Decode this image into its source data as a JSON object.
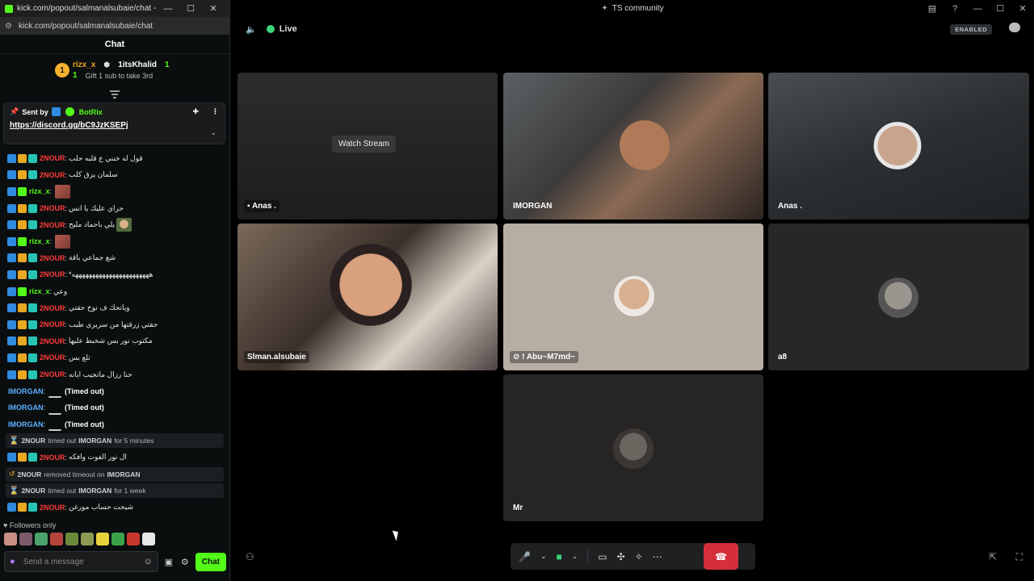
{
  "chat_window": {
    "title": "kick.com/popout/salmanalsubaie/chat - Google...",
    "url": "kick.com/popout/salmanalsubaie/chat",
    "header": "Chat",
    "leaderboard": {
      "rank": "1",
      "first": {
        "name": "rizx_x",
        "count": "1"
      },
      "second": {
        "name": "1itsKhalid",
        "count": "1"
      },
      "gift_text": "Gift 1 sub to take 3rd"
    },
    "pinned": {
      "sent_by_label": "Sent by",
      "bot_name": "BotRix",
      "link": "https://discord.gg/bC9JzKSEPj"
    },
    "messages": [
      {
        "badges": [
          "blue",
          "gold",
          "teal"
        ],
        "user": "2NOUR",
        "color": "red",
        "text": "قول له خنني ع قلبه حلب"
      },
      {
        "badges": [
          "blue",
          "gold",
          "teal"
        ],
        "user": "2NOUR",
        "color": "red",
        "text": "سلمان يزق كلب"
      },
      {
        "badges": [
          "blue",
          "green"
        ],
        "user": "rizx_x",
        "color": "green",
        "text": "",
        "emote": "red"
      },
      {
        "badges": [
          "blue",
          "gold",
          "teal"
        ],
        "user": "2NOUR",
        "color": "red",
        "text": "حراي عليك يا انس"
      },
      {
        "badges": [
          "blue",
          "gold",
          "teal"
        ],
        "user": "2NOUR",
        "color": "red",
        "text": "يلي باحماد مليح",
        "emote": "face"
      },
      {
        "badges": [
          "blue",
          "green"
        ],
        "user": "rizx_x",
        "color": "green",
        "text": "",
        "emote": "red"
      },
      {
        "badges": [
          "blue",
          "gold",
          "teal"
        ],
        "user": "2NOUR",
        "color": "red",
        "text": "شع جماعي باقة"
      },
      {
        "badges": [
          "blue",
          "gold",
          "teal"
        ],
        "user": "2NOUR",
        "color": "red",
        "text": "*هههههههههههههههههههههههه"
      },
      {
        "badges": [
          "blue",
          "green"
        ],
        "user": "rizx_x",
        "color": "green",
        "text": "وعي"
      },
      {
        "badges": [
          "blue",
          "gold",
          "teal"
        ],
        "user": "2NOUR",
        "color": "red",
        "text": "ويانحك ف نوح حقتي"
      },
      {
        "badges": [
          "blue",
          "gold",
          "teal"
        ],
        "user": "2NOUR",
        "color": "red",
        "text": "حقتي زرقتها من سريري طيب"
      },
      {
        "badges": [
          "blue",
          "gold",
          "teal"
        ],
        "user": "2NOUR",
        "color": "red",
        "text": "مكتوب نور بس شخبط عليها"
      },
      {
        "badges": [
          "blue",
          "gold",
          "teal"
        ],
        "user": "2NOUR",
        "color": "red",
        "text": "تلع بس"
      },
      {
        "badges": [
          "blue",
          "gold",
          "teal"
        ],
        "user": "2NOUR",
        "color": "red",
        "text": "حنا رزال ماتجيب ابانه"
      },
      {
        "badges": [],
        "user": "IMORGAN",
        "color": "blue",
        "text": "",
        "emote": "white",
        "timed_out": "(Timed out)"
      },
      {
        "badges": [],
        "user": "IMORGAN",
        "color": "blue",
        "text": "",
        "emote": "white",
        "timed_out": "(Timed out)"
      },
      {
        "badges": [],
        "user": "IMORGAN",
        "color": "blue",
        "text": "",
        "emote": "white",
        "timed_out": "(Timed out)"
      }
    ],
    "system_1": {
      "actor": "2NOUR",
      "verb": "timed out",
      "target": "IMORGAN",
      "suffix": "for 5 minutes"
    },
    "msg_after_sys1": {
      "user": "2NOUR",
      "text": "ال نور الفوت وافكه"
    },
    "system_2": {
      "actor": "2NOUR",
      "verb": "removed timeout on",
      "target": "IMORGAN"
    },
    "system_3": {
      "actor": "2NOUR",
      "verb": "timed out",
      "target": "IMORGAN",
      "suffix": "for 1 week"
    },
    "msg_last": {
      "user": "2NOUR",
      "text": "شيحت حساب مورغن"
    },
    "followers_only": "Followers only",
    "input_placeholder": "Send a message",
    "chat_button": "Chat"
  },
  "call_window": {
    "title": "TS community",
    "status": "Live",
    "enabled_badge": "ENABLED",
    "watch_stream": "Watch Stream",
    "tiles": [
      {
        "name": "Anas ."
      },
      {
        "name": "IMORGAN"
      },
      {
        "name": "Anas ."
      },
      {
        "name": "Slman.alsubaie"
      },
      {
        "name": "! Abu~M7md~"
      },
      {
        "name": "a8"
      },
      {
        "name": "Mr"
      }
    ]
  },
  "colors": {
    "kick_green": "#53fc18",
    "hangup_red": "#d5303a",
    "user_red": "#ff3b3b",
    "user_blue": "#5ab0ff",
    "voice_green": "#3ad47a"
  }
}
